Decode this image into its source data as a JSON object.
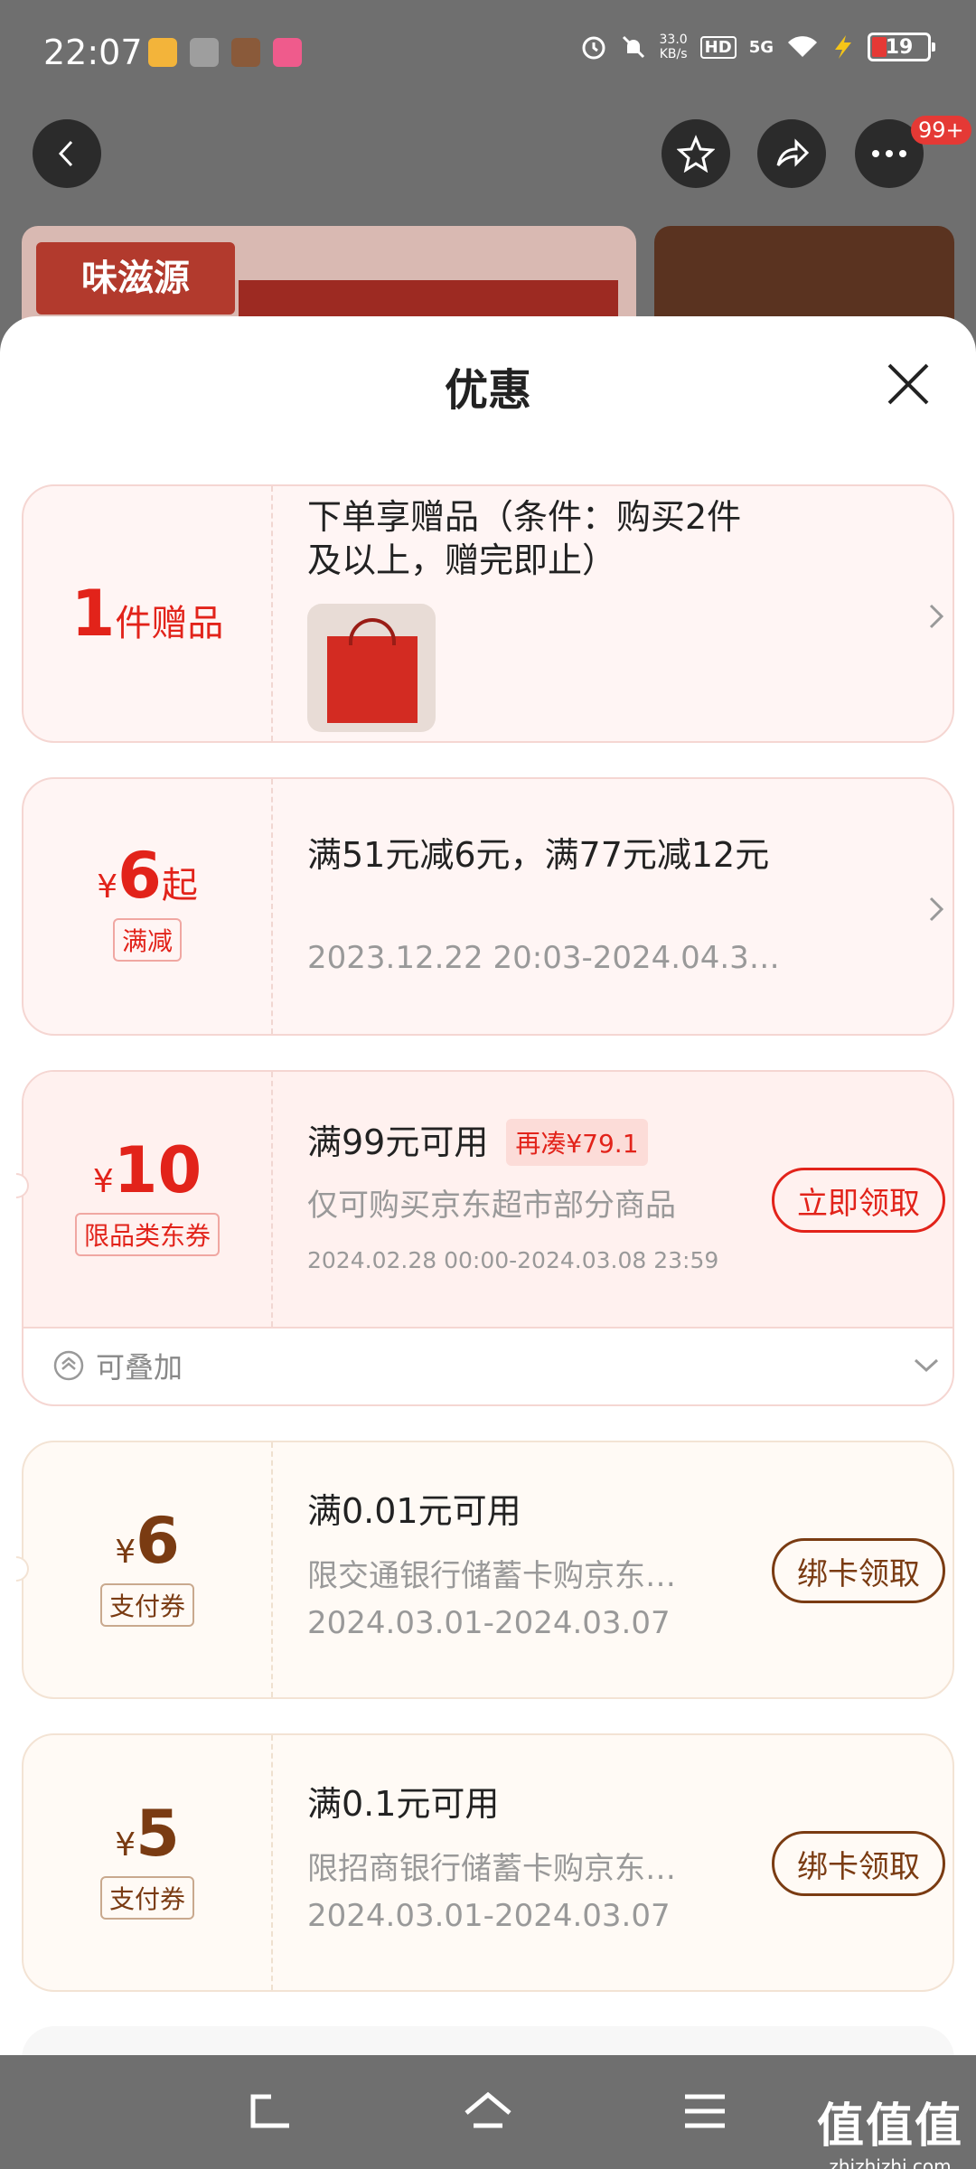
{
  "status_bar": {
    "time": "22:07",
    "net_speed_value": "33.0",
    "net_speed_unit": "KB/s",
    "hd": "HD",
    "signal": "5G",
    "battery": "19"
  },
  "header": {
    "cart_badge": "99+"
  },
  "background": {
    "logo_text": "味滋源"
  },
  "sheet": {
    "title": "优惠",
    "cards": [
      {
        "amount": "1",
        "amount_suffix": "件赠品",
        "description": "下单享赠品（条件：购买2件及以上，赠完即止）"
      },
      {
        "currency": "¥",
        "amount": "6",
        "amount_suffix": "起",
        "tag": "满减",
        "description": "满51元减6元，满77元减12元",
        "date": "2023.12.22 20:03-2024.04.3…"
      },
      {
        "currency": "¥",
        "amount": "10",
        "tag": "限品类东券",
        "condition": "满99元可用",
        "extra_tag": "再凑¥79.1",
        "description": "仅可购买京东超市部分商品",
        "date": "2024.02.28 00:00-2024.03.08 23:59",
        "button": "立即领取",
        "stackable": "可叠加"
      },
      {
        "currency": "¥",
        "amount": "6",
        "tag": "支付券",
        "condition": "满0.01元可用",
        "description": "限交通银行储蓄卡购京东…",
        "date": "2024.03.01-2024.03.07",
        "button": "绑卡领取"
      },
      {
        "currency": "¥",
        "amount": "5",
        "tag": "支付券",
        "condition": "满0.1元可用",
        "description": "限招商银行储蓄卡购京东…",
        "date": "2024.03.01-2024.03.07",
        "button": "绑卡领取"
      }
    ]
  },
  "watermark": {
    "title": "值值值",
    "domain": "zhizhizhi.com"
  },
  "colors": {
    "accent_red": "#e2231a",
    "accent_brown": "#7a3b12"
  }
}
